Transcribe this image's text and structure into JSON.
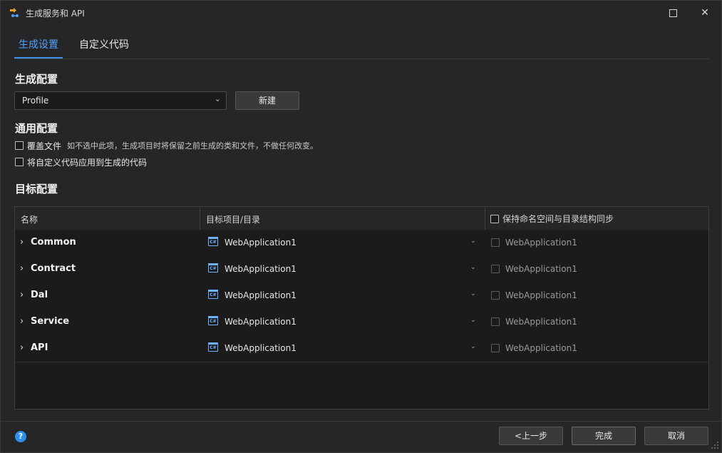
{
  "window": {
    "title": "生成服务和 API",
    "maximize_icon": "maximize-icon",
    "close_icon": "close-icon",
    "close_glyph": "✕"
  },
  "tabs": [
    {
      "label": "生成设置",
      "active": true
    },
    {
      "label": "自定义代码",
      "active": false
    }
  ],
  "generation_config": {
    "heading": "生成配置",
    "profile_value": "Profile",
    "new_button": "新建"
  },
  "general_config": {
    "heading": "通用配置",
    "overwrite_label": "覆盖文件",
    "overwrite_hint": "如不选中此项，生成项目时将保留之前生成的类和文件，不做任何改变。",
    "apply_custom_label": "将自定义代码应用到生成的代码"
  },
  "target_config": {
    "heading": "目标配置",
    "columns": {
      "name": "名称",
      "target": "目标项目/目录",
      "sync": "保持命名空间与目录结构同步"
    },
    "rows": [
      {
        "name": "Common",
        "project": "WebApplication1",
        "sync_text": "WebApplication1"
      },
      {
        "name": "Contract",
        "project": "WebApplication1",
        "sync_text": "WebApplication1"
      },
      {
        "name": "Dal",
        "project": "WebApplication1",
        "sync_text": "WebApplication1"
      },
      {
        "name": "Service",
        "project": "WebApplication1",
        "sync_text": "WebApplication1"
      },
      {
        "name": "API",
        "project": "WebApplication1",
        "sync_text": "WebApplication1"
      }
    ]
  },
  "footer": {
    "help_glyph": "?",
    "prev_button": "<上一步",
    "finish_button": "完成",
    "cancel_button": "取消"
  },
  "glyphs": {
    "expander": "›",
    "dropdown": "⌄",
    "cs_icon_text": "C#"
  },
  "colors": {
    "accent": "#3b8fe8",
    "background": "#262628",
    "table_background": "#1b1b1c"
  }
}
